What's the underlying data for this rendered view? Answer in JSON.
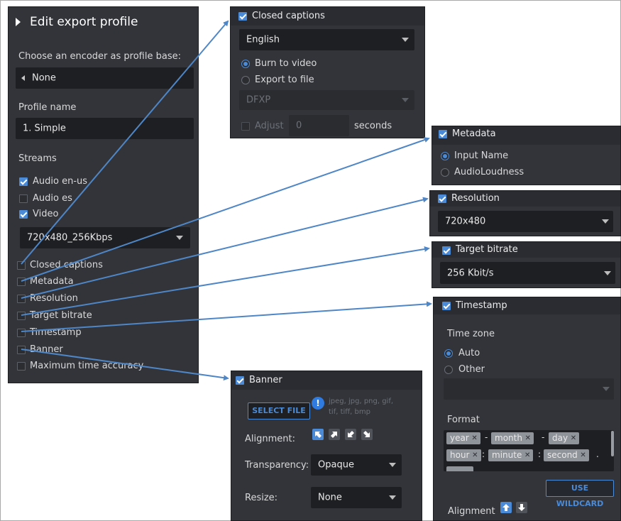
{
  "left_panel": {
    "title": "Edit export profile",
    "encoder_label": "Choose an encoder as profile base:",
    "encoder_value": "None",
    "profile_name_label": "Profile name",
    "profile_name_value": "1. Simple",
    "streams_label": "Streams",
    "streams": [
      {
        "label": "Audio en-us",
        "checked": true
      },
      {
        "label": "Audio es",
        "checked": false
      },
      {
        "label": "Video",
        "checked": true
      }
    ],
    "video_preset": "720x480_256Kbps",
    "options": [
      {
        "label": "Closed captions",
        "checked": false
      },
      {
        "label": "Metadata",
        "checked": false
      },
      {
        "label": "Resolution",
        "checked": false
      },
      {
        "label": "Target bitrate",
        "checked": false
      },
      {
        "label": "Timestamp",
        "checked": false
      },
      {
        "label": "Banner",
        "checked": false
      },
      {
        "label": "Maximum time accuracy",
        "checked": false
      }
    ]
  },
  "closed_captions": {
    "title": "Closed captions",
    "language": "English",
    "burn_label": "Burn to video",
    "export_label": "Export to file",
    "format": "DFXP",
    "adjust_label": "Adjust",
    "adjust_value": "0",
    "seconds_label": "seconds"
  },
  "metadata": {
    "title": "Metadata",
    "option1": "Input Name",
    "option2": "AudioLoudness"
  },
  "resolution": {
    "title": "Resolution",
    "value": "720x480"
  },
  "target_bitrate": {
    "title": "Target bitrate",
    "value": "256 Kbit/s"
  },
  "timestamp": {
    "title": "Timestamp",
    "timezone_label": "Time zone",
    "auto_label": "Auto",
    "other_label": "Other",
    "format_label": "Format",
    "tokens_row1": [
      "year",
      "month",
      "day"
    ],
    "tokens_row2": [
      "hour",
      "minute",
      "second"
    ],
    "sep_dash": "-",
    "sep_colon": ":",
    "sep_dot": ".",
    "wildcard_button": "USE WILDCARD",
    "alignment_label": "Alignment"
  },
  "banner": {
    "title": "Banner",
    "select_file": "SELECT FILE",
    "info_mark": "!",
    "file_types_line1": "jpeg, jpg, png, gif,",
    "file_types_line2": "tif, tiff, bmp",
    "alignment_label": "Alignment:",
    "transparency_label": "Transparency:",
    "transparency_value": "Opaque",
    "resize_label": "Resize:",
    "resize_value": "None"
  },
  "colors": {
    "panel_bg": "#32343a",
    "field_bg": "#1e1f22",
    "accent": "#4a8ad6",
    "arrow": "#4f86c6"
  }
}
